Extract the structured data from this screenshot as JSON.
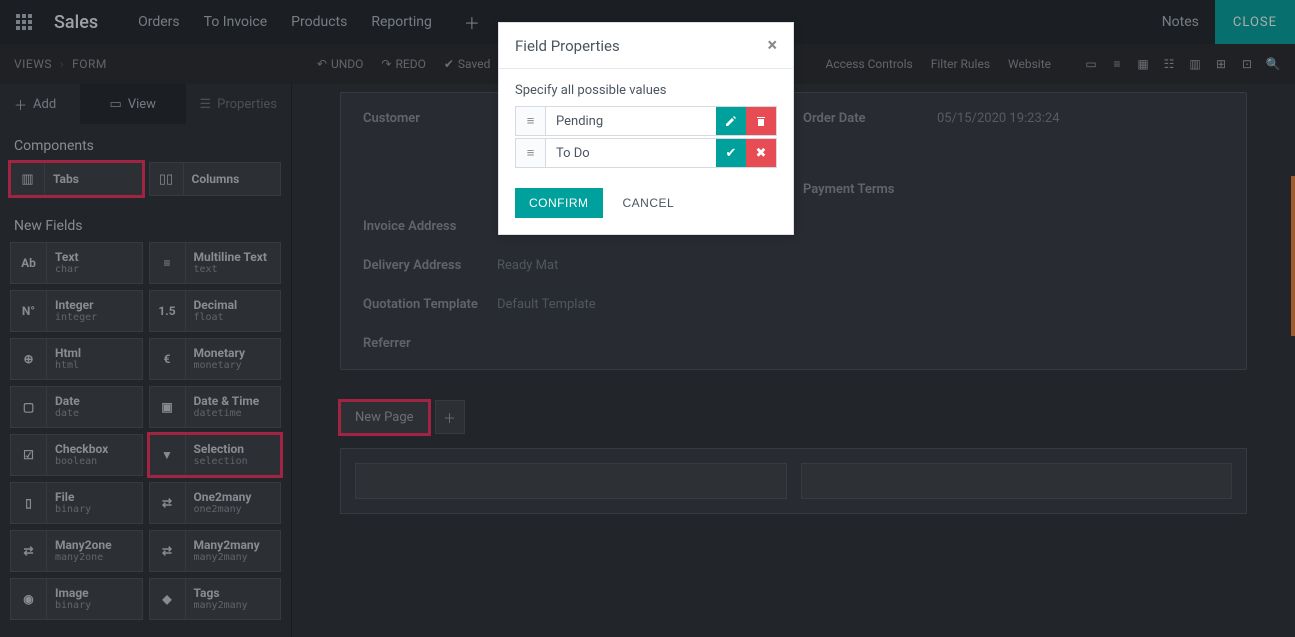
{
  "topnav": {
    "app_title": "Sales",
    "items": [
      "Orders",
      "To Invoice",
      "Products",
      "Reporting"
    ],
    "notes": "Notes",
    "close": "CLOSE"
  },
  "secondbar": {
    "breadcrumb": [
      "VIEWS",
      "FORM"
    ],
    "undo": "UNDO",
    "redo": "REDO",
    "saved": "Saved",
    "links": [
      "Access Controls",
      "Filter Rules",
      "Website"
    ]
  },
  "sidebar_tabs": {
    "add": "Add",
    "view": "View",
    "props": "Properties"
  },
  "sections": {
    "components": "Components",
    "new_fields": "New Fields"
  },
  "components": {
    "tabs": "Tabs",
    "columns": "Columns"
  },
  "fields": [
    {
      "name": "Text",
      "sub": "char",
      "ico": "Ab"
    },
    {
      "name": "Multiline Text",
      "sub": "text",
      "ico": "≡"
    },
    {
      "name": "Integer",
      "sub": "integer",
      "ico": "N°"
    },
    {
      "name": "Decimal",
      "sub": "float",
      "ico": "1.5"
    },
    {
      "name": "Html",
      "sub": "html",
      "ico": "⊕"
    },
    {
      "name": "Monetary",
      "sub": "monetary",
      "ico": "€"
    },
    {
      "name": "Date",
      "sub": "date",
      "ico": "▢"
    },
    {
      "name": "Date & Time",
      "sub": "datetime",
      "ico": "▣"
    },
    {
      "name": "Checkbox",
      "sub": "boolean",
      "ico": "☑"
    },
    {
      "name": "Selection",
      "sub": "selection",
      "ico": "▼"
    },
    {
      "name": "File",
      "sub": "binary",
      "ico": "▯"
    },
    {
      "name": "One2many",
      "sub": "one2many",
      "ico": "⇄"
    },
    {
      "name": "Many2one",
      "sub": "many2one",
      "ico": "⇄"
    },
    {
      "name": "Many2many",
      "sub": "many2many",
      "ico": "⇄"
    },
    {
      "name": "Image",
      "sub": "binary",
      "ico": "◉"
    },
    {
      "name": "Tags",
      "sub": "many2many",
      "ico": "◆"
    }
  ],
  "form": {
    "customer_label": "Customer",
    "invoice_addr_label": "Invoice Address",
    "delivery_addr_label": "Delivery Address",
    "delivery_addr_value": "Ready Mat",
    "quote_tpl_label": "Quotation Template",
    "quote_tpl_value": "Default Template",
    "referrer_label": "Referrer",
    "order_date_label": "Order Date",
    "order_date_value": "05/15/2020 19:23:24",
    "payment_terms_label": "Payment Terms"
  },
  "page_tabs": {
    "new_page": "New Page"
  },
  "modal": {
    "title": "Field Properties",
    "hint": "Specify all possible values",
    "values": [
      {
        "text": "Pending",
        "mode": "edit-delete"
      },
      {
        "text": "To Do",
        "mode": "confirm-cancel"
      }
    ],
    "confirm": "CONFIRM",
    "cancel": "CANCEL"
  }
}
